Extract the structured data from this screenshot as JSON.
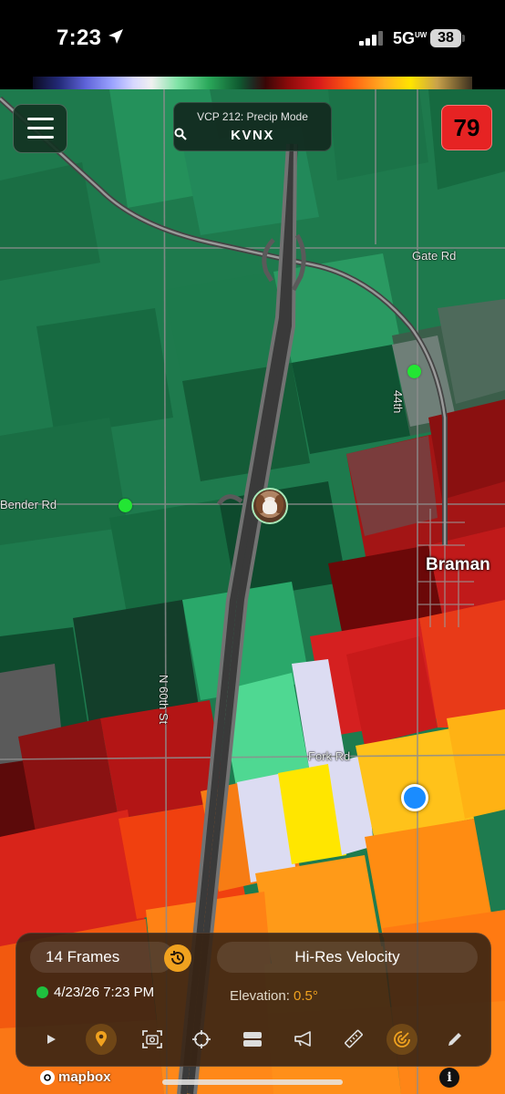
{
  "status_bar": {
    "time": "7:23",
    "network": "5G",
    "network_sup": "UW",
    "battery": "38"
  },
  "radar": {
    "vcp_mode": "VCP 212: Precip Mode",
    "station": "KVNX",
    "alert_count": "79"
  },
  "map": {
    "roads": {
      "gate_rd": "Gate Rd",
      "street_44th": "44th",
      "bender_rd": "Bender Rd",
      "n60th_st": "N 60th St",
      "fork_rd": "Fork Rd"
    },
    "city": "Braman"
  },
  "panel": {
    "frames": "14 Frames",
    "product": "Hi-Res Velocity",
    "timestamp": "4/23/26 7:23 PM",
    "elevation_label": "Elevation:",
    "elevation_value": "0.5°",
    "status_color": "#1fc13f",
    "accent_color": "#f0a21f"
  },
  "toolbar": {
    "icons": [
      "play-icon",
      "map-pin-icon",
      "screenshot-icon",
      "crosshair-icon",
      "layers-icon",
      "megaphone-icon",
      "ruler-icon",
      "radar-icon",
      "pencil-icon"
    ],
    "active": [
      "map-pin-icon",
      "radar-icon"
    ]
  },
  "attribution": {
    "mapbox": "mapbox",
    "info": "i"
  }
}
